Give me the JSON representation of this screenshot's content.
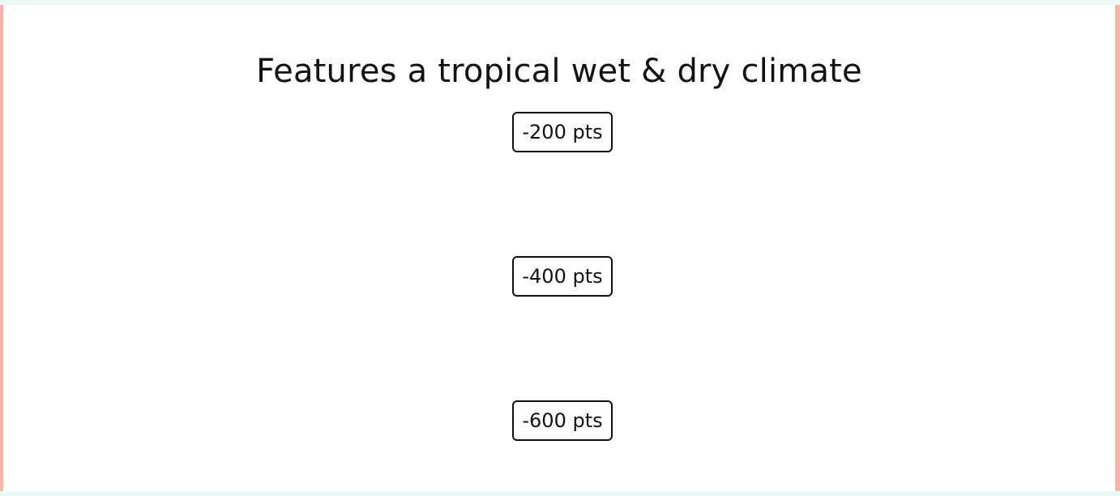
{
  "question": {
    "prompt": "Features a tropical wet & dry climate"
  },
  "options": [
    {
      "label": "-200 pts"
    },
    {
      "label": "-400 pts"
    },
    {
      "label": "-600 pts"
    }
  ],
  "colors": {
    "page_background": "#eafbf4",
    "panel_background": "#ffffff",
    "side_accent": "#f7b4a7",
    "text": "#111111",
    "button_border": "#111111"
  }
}
